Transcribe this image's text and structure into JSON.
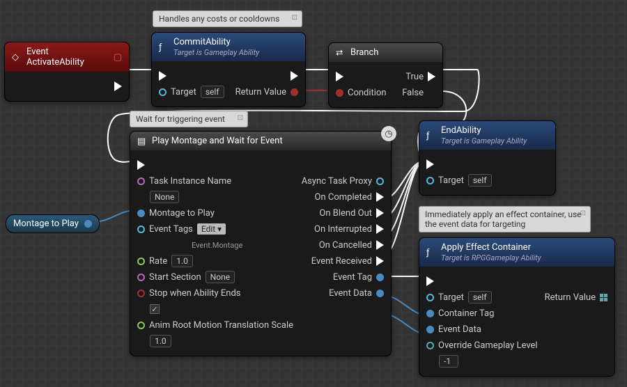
{
  "comments": {
    "c1": "Handles any costs or cooldowns",
    "c2": "Wait for triggering event",
    "c3": "Immediately apply an effect container, use the event data for targeting"
  },
  "eventNode": {
    "title": "Event ActivateAbility"
  },
  "commit": {
    "title": "CommitAbility",
    "sub": "Target is Gameplay Ability",
    "target": "Target",
    "self": "self",
    "retval": "Return Value"
  },
  "branch": {
    "title": "Branch",
    "cond": "Condition",
    "t": "True",
    "f": "False"
  },
  "montage": {
    "title": "Play Montage and Wait for Event",
    "taskName": "Task Instance Name",
    "taskVal": "None",
    "toPlay": "Montage to Play",
    "tags": "Event Tags",
    "tagsBtn": "Edit",
    "tagsVal": "Event.Montage",
    "rate": "Rate",
    "rateVal": "1.0",
    "start": "Start Section",
    "startVal": "None",
    "stop": "Stop when Ability Ends",
    "anim": "Anim Root Motion Translation Scale",
    "animVal": "1.0",
    "proxy": "Async Task Proxy",
    "comp": "On Completed",
    "blend": "On Blend Out",
    "intr": "On Interrupted",
    "canc": "On Cancelled",
    "recv": "Event Received",
    "etag": "Event Tag",
    "edata": "Event Data"
  },
  "end": {
    "title": "EndAbility",
    "sub": "Target is Gameplay Ability",
    "target": "Target",
    "self": "self"
  },
  "apply": {
    "title": "Apply Effect Container",
    "sub": "Target is RPGGameplay Ability",
    "target": "Target",
    "self": "self",
    "ctag": "Container Tag",
    "edata": "Event Data",
    "ovr": "Override Gameplay Level",
    "ovrVal": "-1",
    "retval": "Return Value"
  },
  "var": {
    "name": "Montage to Play"
  }
}
